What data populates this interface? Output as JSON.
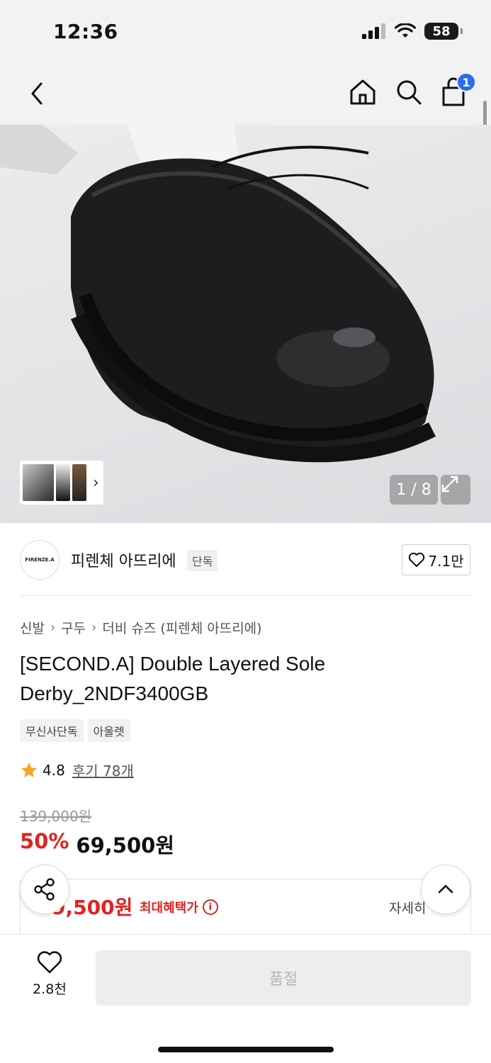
{
  "status": {
    "time": "12:36",
    "battery": "58"
  },
  "nav": {
    "back_icon": "chevron-left-icon",
    "home_icon": "home-icon",
    "search_icon": "search-icon",
    "cart_icon": "shopping-bag-icon",
    "cart_count": "1"
  },
  "gallery": {
    "counter": "1 / 8",
    "expand_icon": "expand-icon"
  },
  "brand": {
    "logo_text": "FIRENZE.A",
    "name": "피렌체 아뜨리에",
    "badge": "단독",
    "likes": "7.1만"
  },
  "breadcrumb": [
    "신발",
    "구두",
    "더비 슈즈 (피렌체 아뜨리에)"
  ],
  "product": {
    "title": "[SECOND.A] Double Layered Sole Derby_2NDF3400GB",
    "tags": [
      "무신사단독",
      "아울렛"
    ],
    "rating": "4.8",
    "reviews": "후기 78개",
    "original_price": "139,000원",
    "discount": "50%",
    "price": "69,500원"
  },
  "benefit": {
    "price": "9,500원",
    "label": "최대혜택가",
    "detail": "자세히"
  },
  "bottom": {
    "wish_count": "2.8천",
    "soldout_label": "품절"
  },
  "colors": {
    "accent_red": "#e0231f",
    "badge_blue": "#2a6cf0"
  }
}
